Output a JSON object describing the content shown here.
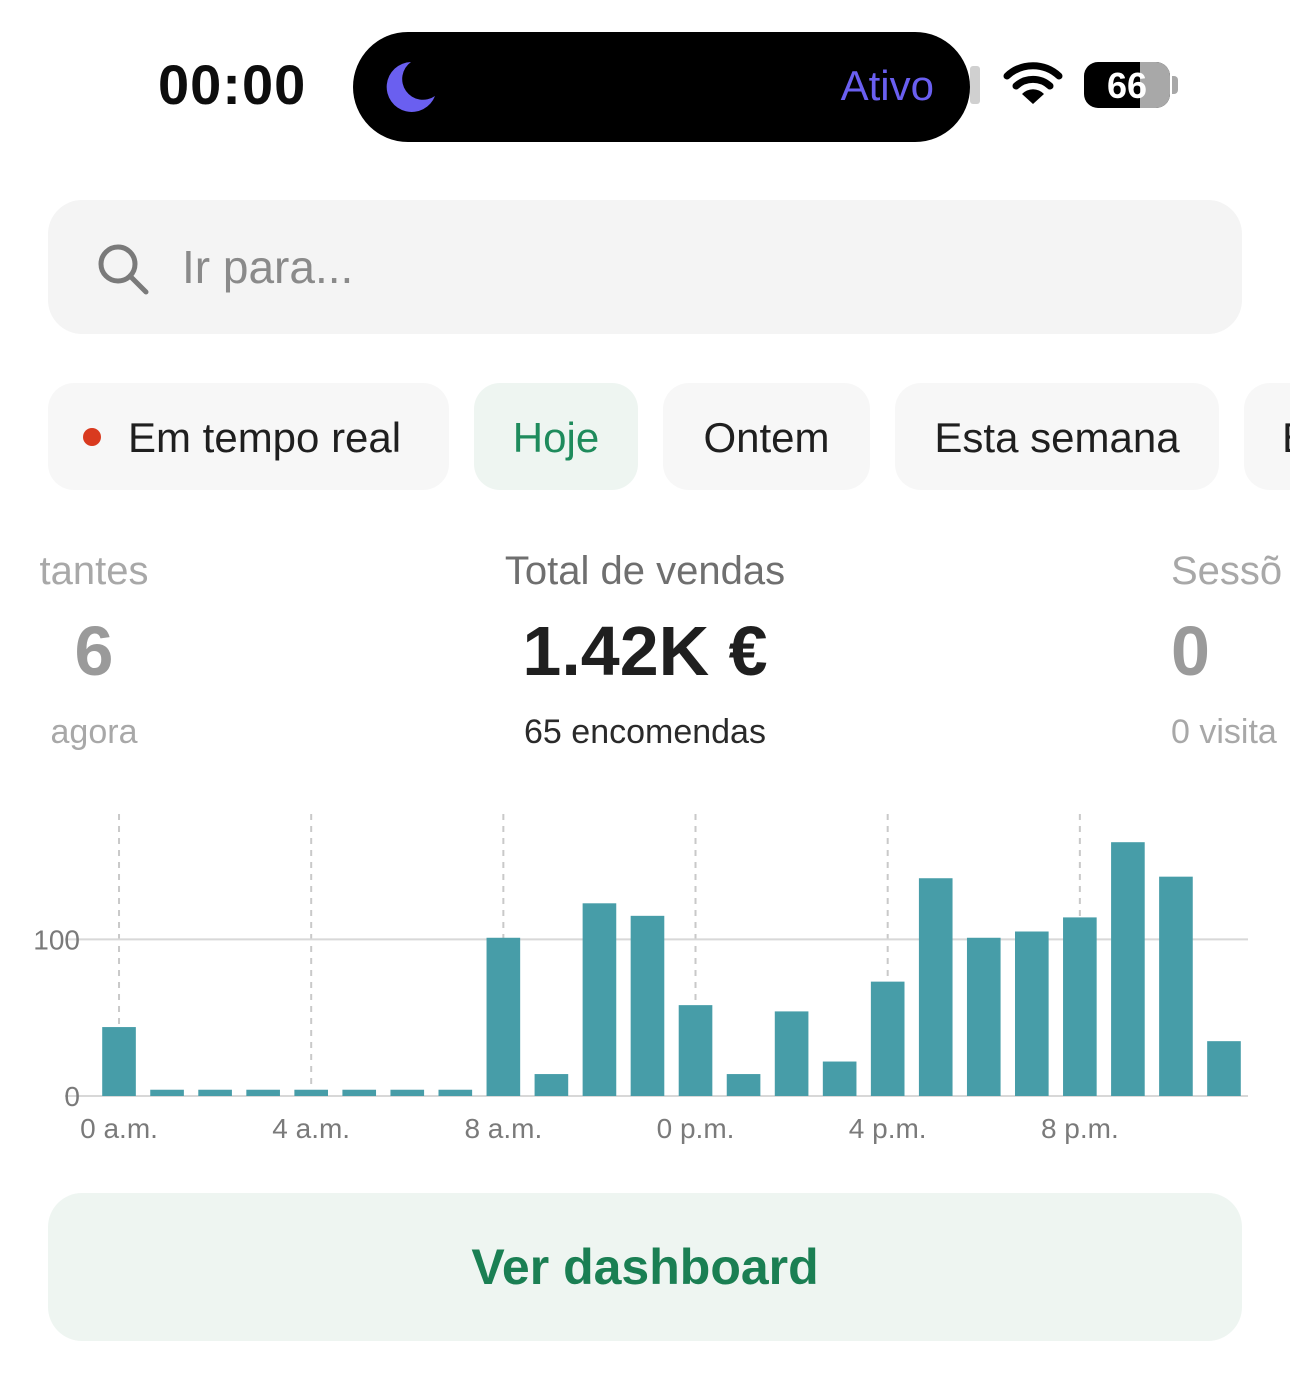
{
  "status_bar": {
    "time": "00:00",
    "focus_label": "Ativo",
    "battery": "66",
    "icons": [
      "moon-icon",
      "wifi-icon",
      "battery-icon"
    ],
    "focus_color": "#6a5ff0"
  },
  "search": {
    "placeholder": "Ir para..."
  },
  "filters": {
    "live": "Em tempo real",
    "today": "Hoje",
    "yesterday": "Ontem",
    "this_week": "Esta semana",
    "next_partial": "E",
    "selected": "Hoje"
  },
  "metrics": {
    "left": {
      "label": "tantes",
      "value": "6",
      "sub": "agora"
    },
    "center": {
      "label": "Total de vendas",
      "value": "1.42K €",
      "sub": "65 encomendas"
    },
    "right": {
      "label": "Sessõ",
      "value": "0",
      "sub": "0 visita"
    }
  },
  "colors": {
    "bar": "#479da8",
    "accent_green": "#1a7f53",
    "live_dot": "#d93a1f"
  },
  "chart_data": {
    "type": "bar",
    "categories": [
      "0 a.m.",
      "1 a.m.",
      "2 a.m.",
      "3 a.m.",
      "4 a.m.",
      "5 a.m.",
      "6 a.m.",
      "7 a.m.",
      "8 a.m.",
      "9 a.m.",
      "10 a.m.",
      "11 a.m.",
      "0 p.m.",
      "1 p.m.",
      "2 p.m.",
      "3 p.m.",
      "4 p.m.",
      "5 p.m.",
      "6 p.m.",
      "7 p.m.",
      "8 p.m.",
      "9 p.m.",
      "10 p.m.",
      "11 p.m."
    ],
    "values": [
      44,
      4,
      4,
      4,
      4,
      4,
      4,
      4,
      101,
      14,
      123,
      115,
      58,
      14,
      54,
      22,
      73,
      139,
      101,
      105,
      114,
      162,
      140,
      35
    ],
    "tick_labels": [
      "0 a.m.",
      "4 a.m.",
      "8 a.m.",
      "0 p.m.",
      "4 p.m.",
      "8 p.m."
    ],
    "y_ticks": [
      0,
      100
    ],
    "ylim": [
      0,
      180
    ],
    "grid": "horizontal at 100; vertical dashed at x ticks"
  },
  "cta": {
    "label": "Ver dashboard"
  }
}
